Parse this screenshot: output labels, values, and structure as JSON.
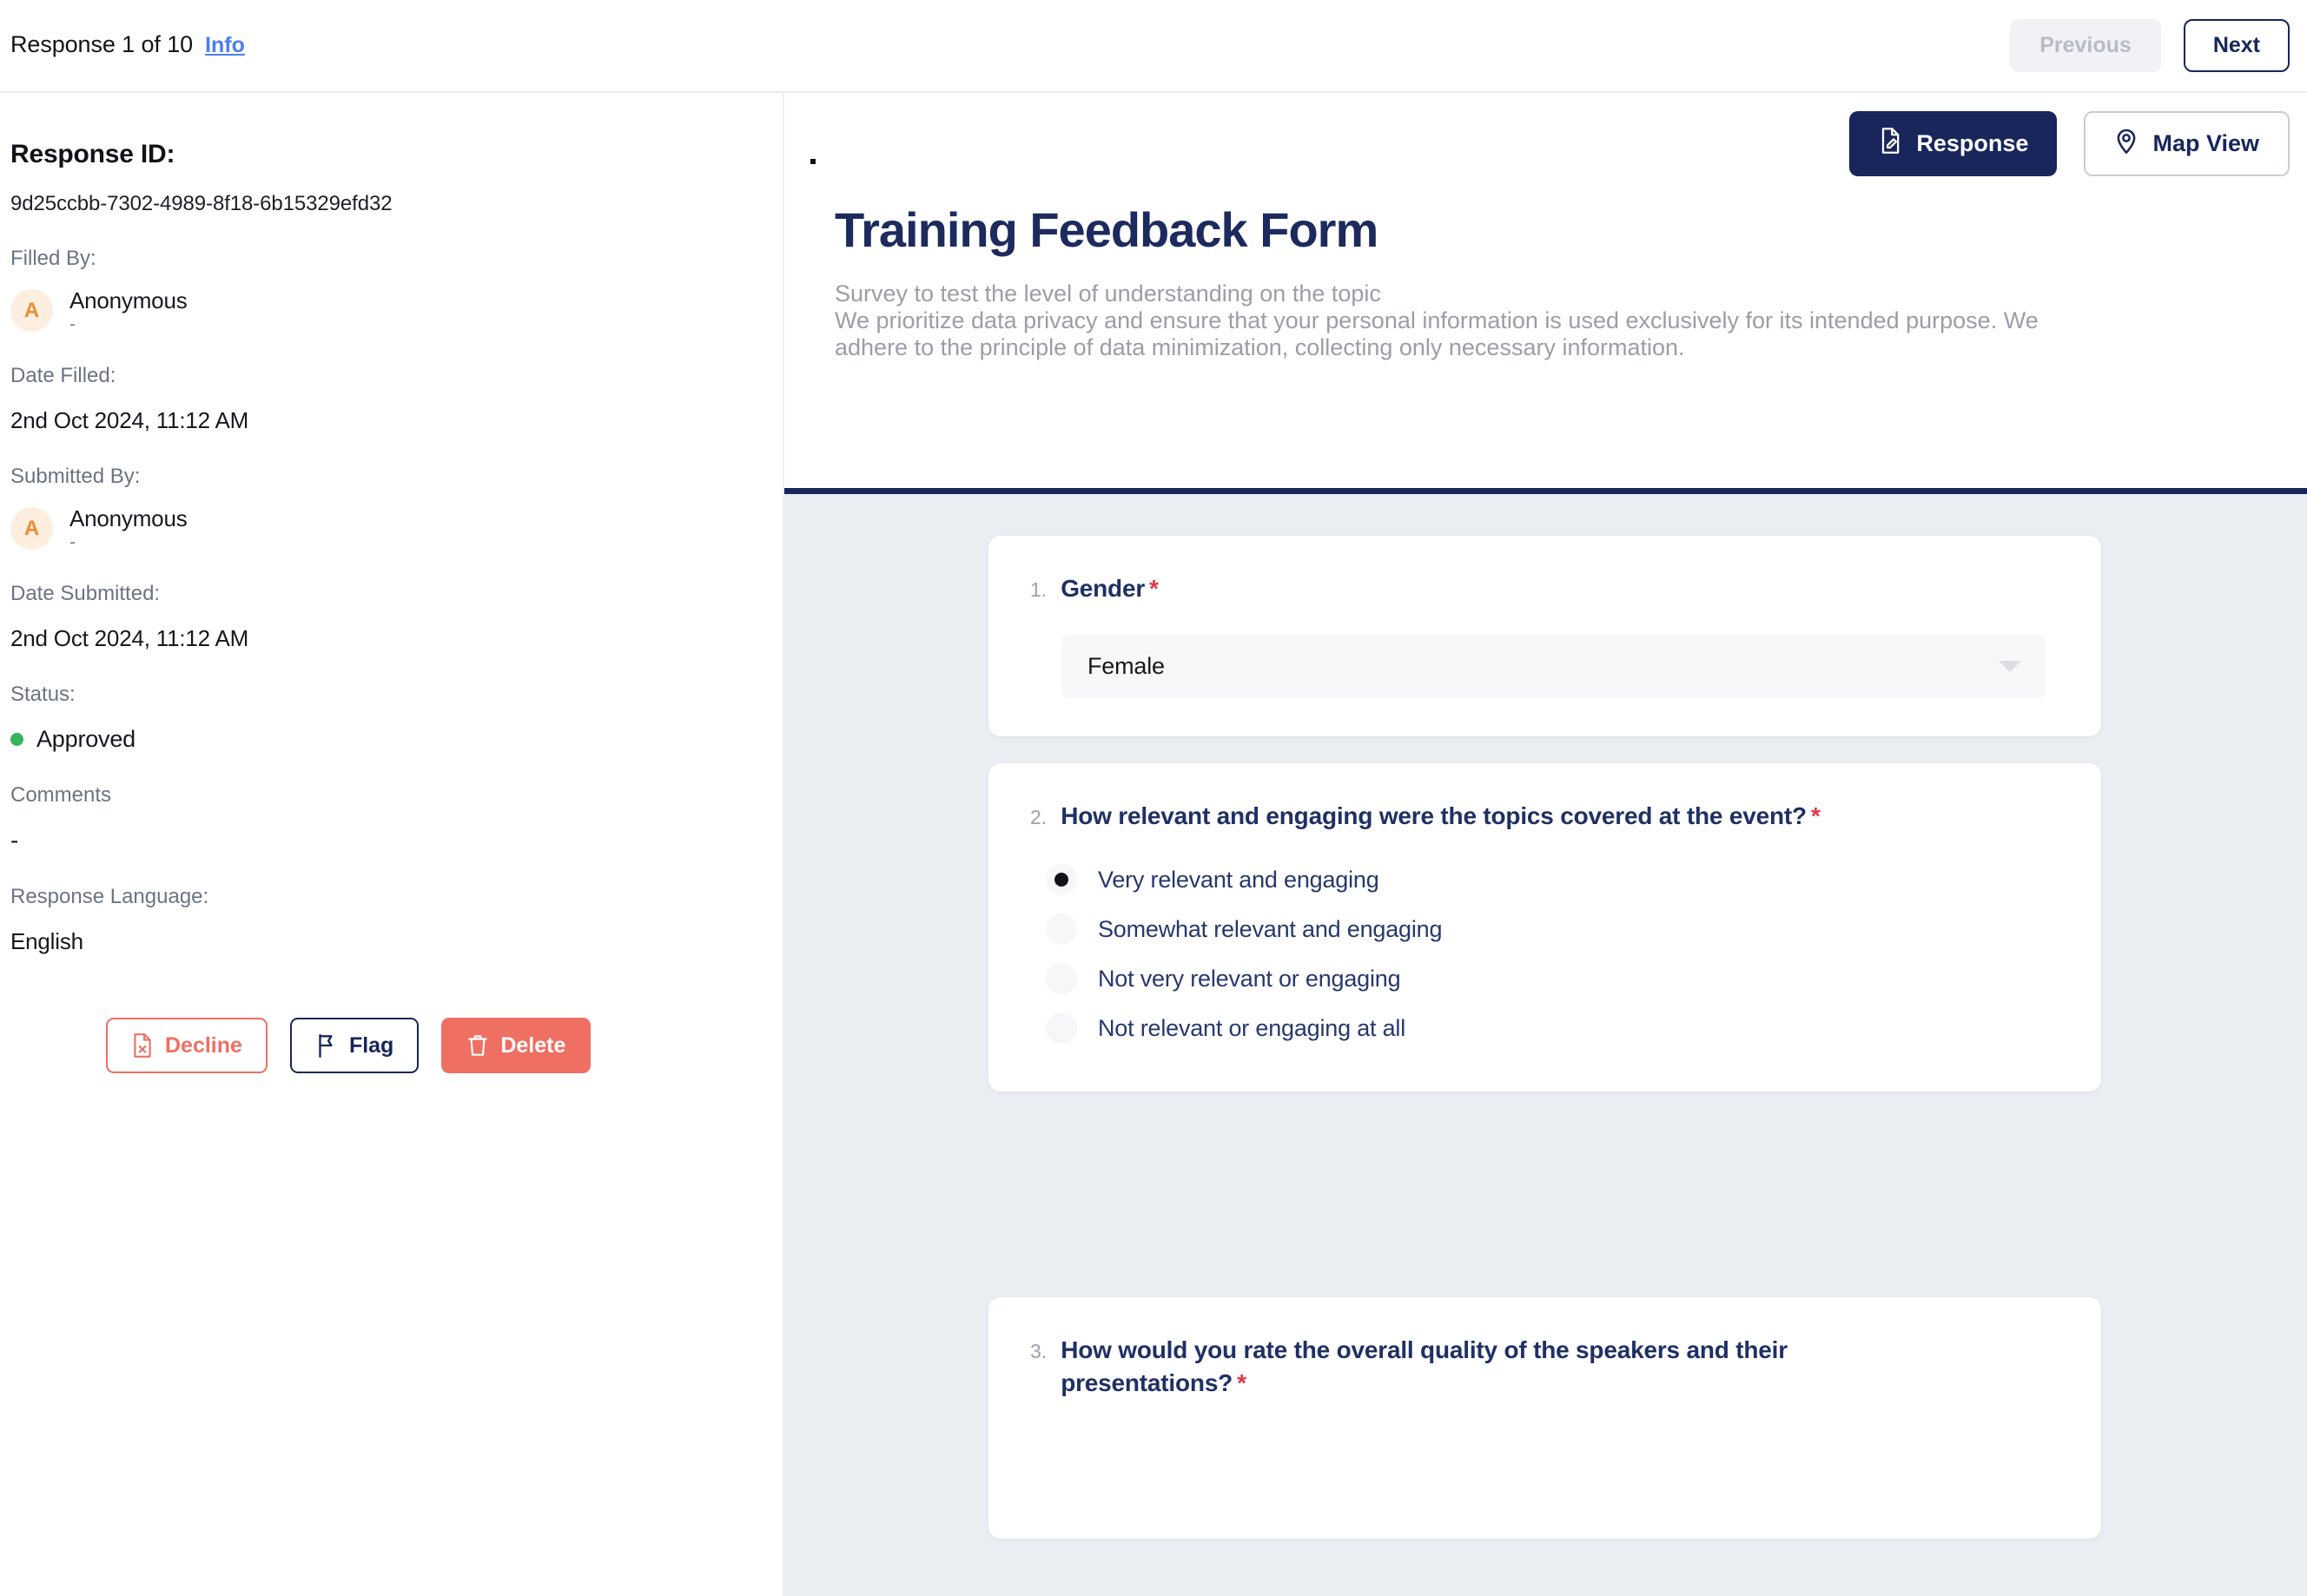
{
  "topbar": {
    "response_counter": "Response 1 of 10",
    "info_link": "Info",
    "previous_label": "Previous",
    "next_label": "Next"
  },
  "sidebar": {
    "response_id_label": "Response ID:",
    "response_id_value": "9d25ccbb-7302-4989-8f18-6b15329efd32",
    "filled_by_label": "Filled By:",
    "filled_by_name": "Anonymous",
    "filled_by_sub": "-",
    "filled_by_initial": "A",
    "date_filled_label": "Date Filled:",
    "date_filled_value": "2nd Oct 2024, 11:12 AM",
    "submitted_by_label": "Submitted By:",
    "submitted_by_name": "Anonymous",
    "submitted_by_sub": "-",
    "submitted_by_initial": "A",
    "date_submitted_label": "Date Submitted:",
    "date_submitted_value": "2nd Oct 2024, 11:12 AM",
    "status_label": "Status:",
    "status_value": "Approved",
    "status_color": "#35b45d",
    "comments_label": "Comments",
    "comments_value": "-",
    "response_language_label": "Response Language:",
    "response_language_value": "English",
    "actions": {
      "decline_label": "Decline",
      "flag_label": "Flag",
      "delete_label": "Delete"
    }
  },
  "main": {
    "response_button": "Response",
    "map_view_button": "Map View",
    "form_title": "Training Feedback Form",
    "form_desc_line1": "Survey to test the level of understanding on the topic",
    "form_desc_line2": "We prioritize data privacy and ensure that your personal information is used exclusively for its intended purpose. We",
    "form_desc_line3": "adhere to the principle of data minimization, collecting only necessary information.",
    "accent_color": "#17265a",
    "required_color": "#e0384a",
    "questions": [
      {
        "number": "1.",
        "text": "Gender",
        "required": "*",
        "type": "select",
        "value": "Female"
      },
      {
        "number": "2.",
        "text": "How relevant and engaging were the topics covered at the event?",
        "required": "*",
        "type": "radio",
        "options": [
          {
            "label": "Very relevant and engaging",
            "selected": true
          },
          {
            "label": "Somewhat relevant and engaging",
            "selected": false
          },
          {
            "label": "Not very relevant or engaging",
            "selected": false
          },
          {
            "label": "Not relevant or engaging at all",
            "selected": false
          }
        ]
      },
      {
        "number": "3.",
        "text": "How would you rate the overall quality of the speakers and their presentations?",
        "required": "*",
        "type": "radio",
        "options": []
      }
    ]
  }
}
